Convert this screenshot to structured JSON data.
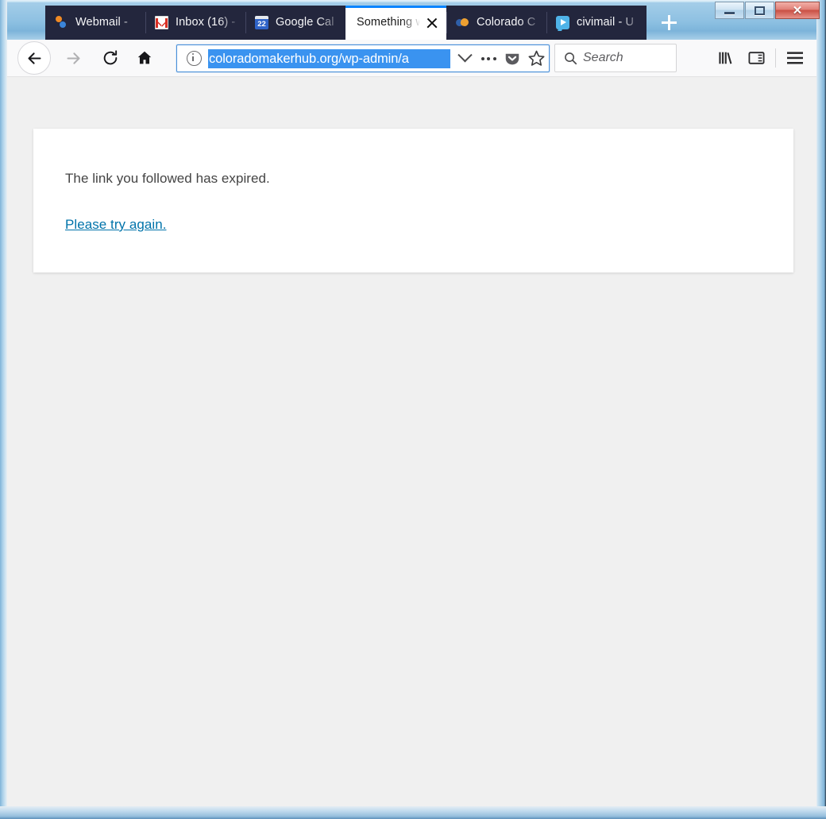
{
  "window": {
    "controls": {
      "minimize_label": "Minimize",
      "maximize_label": "Maximize",
      "close_label": "✕"
    }
  },
  "tabs": [
    {
      "label": "Webmail -",
      "favicon": "webmail-icon",
      "active": false
    },
    {
      "label": "Inbox (16) -",
      "favicon": "gmail-icon",
      "active": false
    },
    {
      "label": "Google Cal",
      "favicon": "google-calendar-icon",
      "calendar_day": "22",
      "active": false
    },
    {
      "label": "Something w",
      "favicon": "none",
      "active": true,
      "close_label": "✕"
    },
    {
      "label": "Colorado C",
      "favicon": "colorado-icon",
      "active": false
    },
    {
      "label": "civimail - U",
      "favicon": "civimail-icon",
      "active": false
    }
  ],
  "newtab": {
    "label": "+"
  },
  "nav": {
    "back_label": "Back",
    "forward_label": "Forward",
    "reload_label": "Reload",
    "home_label": "Home"
  },
  "urlbar": {
    "url": "coloradomakerhub.org/wp-admin/a",
    "site_info_label": "Site information",
    "dropdown_label": "History dropdown",
    "page_actions_label": "Page actions",
    "pocket_label": "Save to Pocket",
    "bookmark_label": "Bookmark this page"
  },
  "search": {
    "placeholder": "Search",
    "value": ""
  },
  "toolbar": {
    "library_label": "Library",
    "sidebar_label": "Sidebars",
    "menu_label": "Open menu"
  },
  "page": {
    "message": "The link you followed has expired.",
    "link_text": "Please try again."
  },
  "colors": {
    "accent": "#0a84ff",
    "tab_background": "#23263d",
    "url_selection": "#3a93f0",
    "link": "#0073aa",
    "content_background": "#f0f0f0"
  }
}
